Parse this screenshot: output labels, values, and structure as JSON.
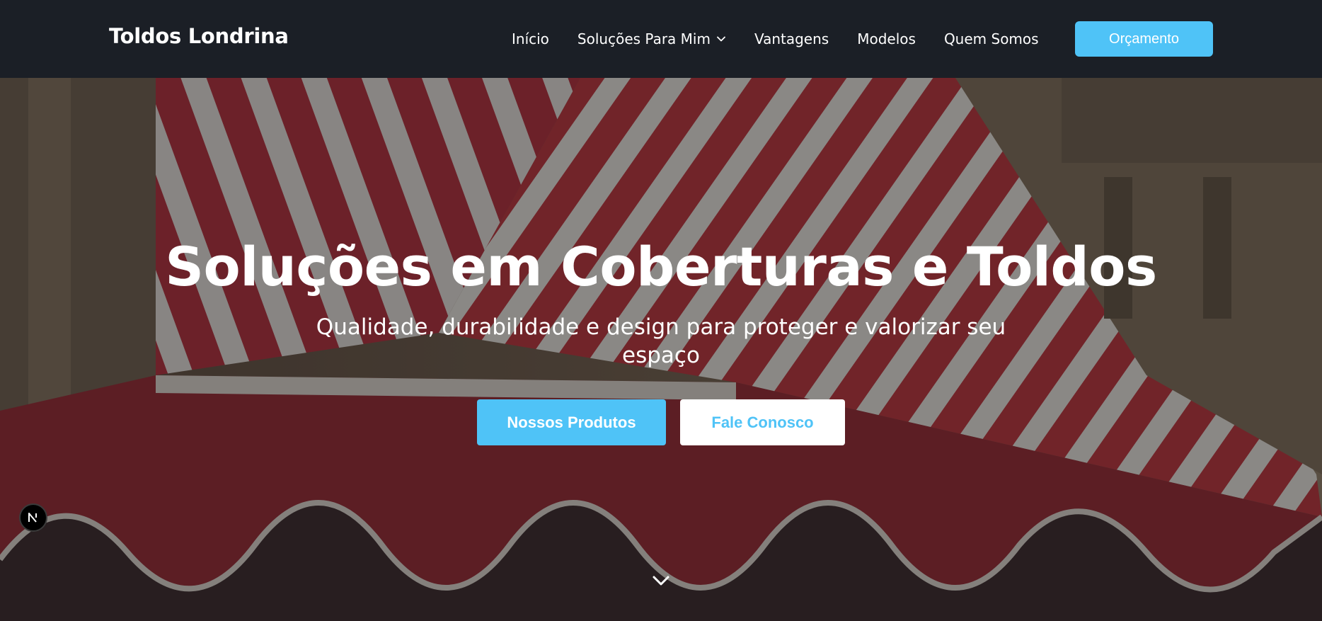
{
  "nav": {
    "brand": "Toldos Londrina",
    "links": [
      {
        "label": "Início"
      },
      {
        "label": "Soluções Para Mim",
        "has_dropdown": true
      },
      {
        "label": "Vantagens"
      },
      {
        "label": "Modelos"
      },
      {
        "label": "Quem Somos"
      }
    ],
    "cta_label": "Orçamento"
  },
  "hero": {
    "title": "Soluções em Coberturas e Toldos",
    "subtitle": "Qualidade, durabilidade e design para proteger e valorizar seu espaço",
    "primary_button": "Nossos Produtos",
    "secondary_button": "Fale Conosco"
  },
  "icons": {
    "dropdown": "chevron-down-icon",
    "scroll": "chevron-down-icon",
    "badge": "nextjs-logo-icon"
  },
  "colors": {
    "navbar_bg": "#1b1f26",
    "accent": "#4fc3f7",
    "text_light": "#ffffff"
  }
}
